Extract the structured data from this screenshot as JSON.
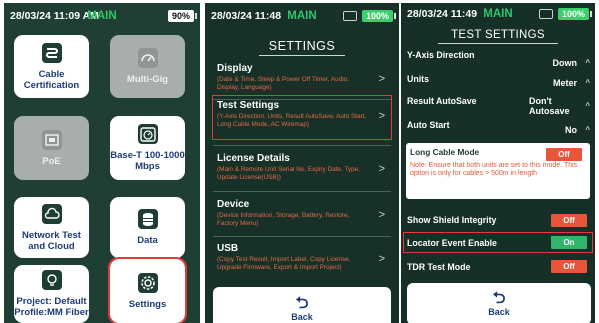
{
  "panel1": {
    "time": "28/03/24 11:09 AM",
    "mode": "MAIN",
    "battery": "90%",
    "tiles": [
      {
        "label": "Cable Certification",
        "icon": "cable-icon",
        "enabled": true
      },
      {
        "label": "Multi-Gig",
        "icon": "gauge-icon",
        "enabled": false
      },
      {
        "label": "PoE",
        "icon": "ethernet-port-icon",
        "enabled": false
      },
      {
        "label": "Base-T 100-1000 Mbps",
        "icon": "speedometer-icon",
        "enabled": true
      },
      {
        "label": "Network Test and Cloud",
        "icon": "cloud-icon",
        "enabled": true
      },
      {
        "label": "Data",
        "icon": "database-icon",
        "enabled": true
      },
      {
        "label": "Project: Default Profile:MM Fiber",
        "icon": "lightbulb-icon",
        "enabled": true
      },
      {
        "label": "Settings",
        "icon": "gear-icon",
        "enabled": true,
        "selected": true
      }
    ]
  },
  "panel2": {
    "time": "28/03/24 11:48",
    "mode": "MAIN",
    "battery": "100%",
    "title": "SETTINGS",
    "items": [
      {
        "label": "Display",
        "desc": "(Date & Time, Sleep & Power Off Timer, Audio, Display, Language)"
      },
      {
        "label": "Test Settings",
        "desc": "(Y-Axis Direction, Units, Result AutoSave, Auto Start, Long Cable Mode, AC Wiremap)",
        "selected": true
      },
      {
        "label": "License Details",
        "desc": "(Main & Remote Unit Serial No, Expiry Date, Type, Update License(USB))"
      },
      {
        "label": "Device",
        "desc": "(Device Information, Storage, Battery, Restore, Factory Menu)"
      },
      {
        "label": "USB",
        "desc": "(Copy Test Result, Import Label, Copy License, Upgrade Firmware, Export & Import Project)"
      }
    ],
    "back_label": "Back"
  },
  "panel3": {
    "time": "28/03/24 11:49",
    "mode": "MAIN",
    "battery": "100%",
    "title": "TEST SETTINGS",
    "rows": {
      "y_axis": {
        "label": "Y-Axis Direction",
        "value": "Down"
      },
      "units": {
        "label": "Units",
        "value": "Meter"
      },
      "autosave": {
        "label": "Result AutoSave",
        "value": "Don't Autosave"
      },
      "autostart": {
        "label": "Auto Start",
        "value": "No"
      }
    },
    "long_cable": {
      "label": "Long Cable Mode",
      "state": "Off",
      "note": "Note: Ensure that both units are set to this mode. This option is only for cables > 500m in length"
    },
    "shield": {
      "label": "Show Shield Integrity",
      "state": "Off"
    },
    "locator": {
      "label": "Locator Event Enable",
      "state": "On"
    },
    "tdr": {
      "label": "TDR Test Mode",
      "state": "Off"
    },
    "back_label": "Back",
    "colors": {
      "off": "#e8553a",
      "on": "#34b36a",
      "accent": "#31c46b",
      "highlight": "#e23a3a"
    }
  }
}
